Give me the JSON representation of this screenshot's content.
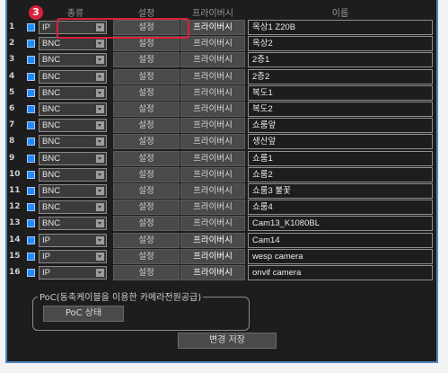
{
  "annotation": {
    "step_number": "3"
  },
  "headers": {
    "type": "종류",
    "settings": "설정",
    "privacy": "프라이버시",
    "name": "이름"
  },
  "rows": [
    {
      "num": "1",
      "type": "IP",
      "setting": "설정",
      "privacy": "프라이버시",
      "name": "옥상1 Z20B",
      "privacy_style": "hi"
    },
    {
      "num": "2",
      "type": "BNC",
      "setting": "설정",
      "privacy": "프라이버시",
      "name": "옥상2",
      "privacy_style": "normal"
    },
    {
      "num": "3",
      "type": "BNC",
      "setting": "설정",
      "privacy": "프라이버시",
      "name": "2층1",
      "privacy_style": "normal"
    },
    {
      "num": "4",
      "type": "BNC",
      "setting": "설정",
      "privacy": "프라이버시",
      "name": "2층2",
      "privacy_style": "normal"
    },
    {
      "num": "5",
      "type": "BNC",
      "setting": "설정",
      "privacy": "프라이버시",
      "name": "복도1",
      "privacy_style": "normal"
    },
    {
      "num": "6",
      "type": "BNC",
      "setting": "설정",
      "privacy": "프라이버시",
      "name": "복도2",
      "privacy_style": "normal"
    },
    {
      "num": "7",
      "type": "BNC",
      "setting": "설정",
      "privacy": "프라이버시",
      "name": "쇼룸앞",
      "privacy_style": "normal"
    },
    {
      "num": "8",
      "type": "BNC",
      "setting": "설정",
      "privacy": "프라이버시",
      "name": "생산앞",
      "privacy_style": "normal"
    },
    {
      "num": "9",
      "type": "BNC",
      "setting": "설정",
      "privacy": "프라이버시",
      "name": "쇼룸1",
      "privacy_style": "normal"
    },
    {
      "num": "10",
      "type": "BNC",
      "setting": "설정",
      "privacy": "프라이버시",
      "name": "쇼룸2",
      "privacy_style": "normal"
    },
    {
      "num": "11",
      "type": "BNC",
      "setting": "설정",
      "privacy": "프라이버시",
      "name": "쇼룸3 불꽃",
      "privacy_style": "normal"
    },
    {
      "num": "12",
      "type": "BNC",
      "setting": "설정",
      "privacy": "프라이버시",
      "name": "쇼룸4",
      "privacy_style": "normal"
    },
    {
      "num": "13",
      "type": "BNC",
      "setting": "설정",
      "privacy": "프라이버시",
      "name": "Cam13_K1080BL",
      "privacy_style": "normal"
    },
    {
      "num": "14",
      "type": "IP",
      "setting": "설정",
      "privacy": "프라이버시",
      "name": "Cam14",
      "privacy_style": "hi"
    },
    {
      "num": "15",
      "type": "IP",
      "setting": "설정",
      "privacy": "프라이버시",
      "name": "wesp camera",
      "privacy_style": "hi"
    },
    {
      "num": "16",
      "type": "IP",
      "setting": "설정",
      "privacy": "프라이버시",
      "name": "onvif camera",
      "privacy_style": "hi"
    }
  ],
  "poc": {
    "legend": "PoC(동축케이블을 이용한 카메라전원공급)",
    "button": "PoC 상태"
  },
  "save_button": "변경 저장",
  "colors": {
    "accent_border": "#4f86c2",
    "highlight": "#d8203b",
    "checkbox": "#1f8bff"
  }
}
